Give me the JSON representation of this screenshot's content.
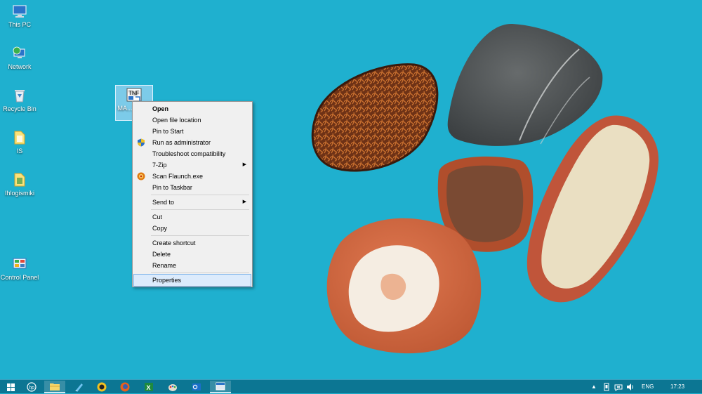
{
  "desktop_icons": [
    {
      "label": "This PC",
      "icon": "this-pc-icon"
    },
    {
      "label": "Network",
      "icon": "network-icon"
    },
    {
      "label": "Recycle Bin",
      "icon": "recycle-bin-icon"
    },
    {
      "label": "IS",
      "icon": "folder-icon"
    },
    {
      "label": "Ihlogismiki",
      "icon": "folder-icon"
    },
    {
      "label": "Control Panel",
      "icon": "control-panel-icon"
    }
  ],
  "selected_icon": {
    "label": "MA... Edu...",
    "icon": "shortcut-icon"
  },
  "context_menu": {
    "items": [
      {
        "label": "Open"
      },
      {
        "label": "Open file location"
      },
      {
        "label": "Pin to Start"
      },
      {
        "label": "Run as administrator",
        "icon": "uac-shield-icon"
      },
      {
        "label": "Troubleshoot compatibility"
      },
      {
        "label": "7-Zip"
      },
      {
        "label": "Scan Flaunch.exe",
        "icon": "antivirus-icon"
      },
      {
        "label": "Pin to Taskbar"
      },
      {
        "label": "Send to"
      },
      {
        "label": "Cut"
      },
      {
        "label": "Copy"
      },
      {
        "label": "Create shortcut"
      },
      {
        "label": "Delete"
      },
      {
        "label": "Rename"
      },
      {
        "label": "Properties"
      }
    ],
    "highlighted": "Properties"
  },
  "taskbar": {
    "apps": [
      "start-icon",
      "hp-icon",
      "file-explorer-icon",
      "store-icon",
      "app-icon",
      "firefox-icon",
      "excel-icon",
      "paint-icon",
      "outlook-icon",
      "window-icon"
    ],
    "tray": {
      "language": "ENG",
      "time": "17:23"
    }
  },
  "colors": {
    "desktop": "#1fb0cf",
    "taskbar": "#0c7693",
    "menu_bg": "#f0f0f0",
    "menu_highlight": "#dcebfc"
  }
}
